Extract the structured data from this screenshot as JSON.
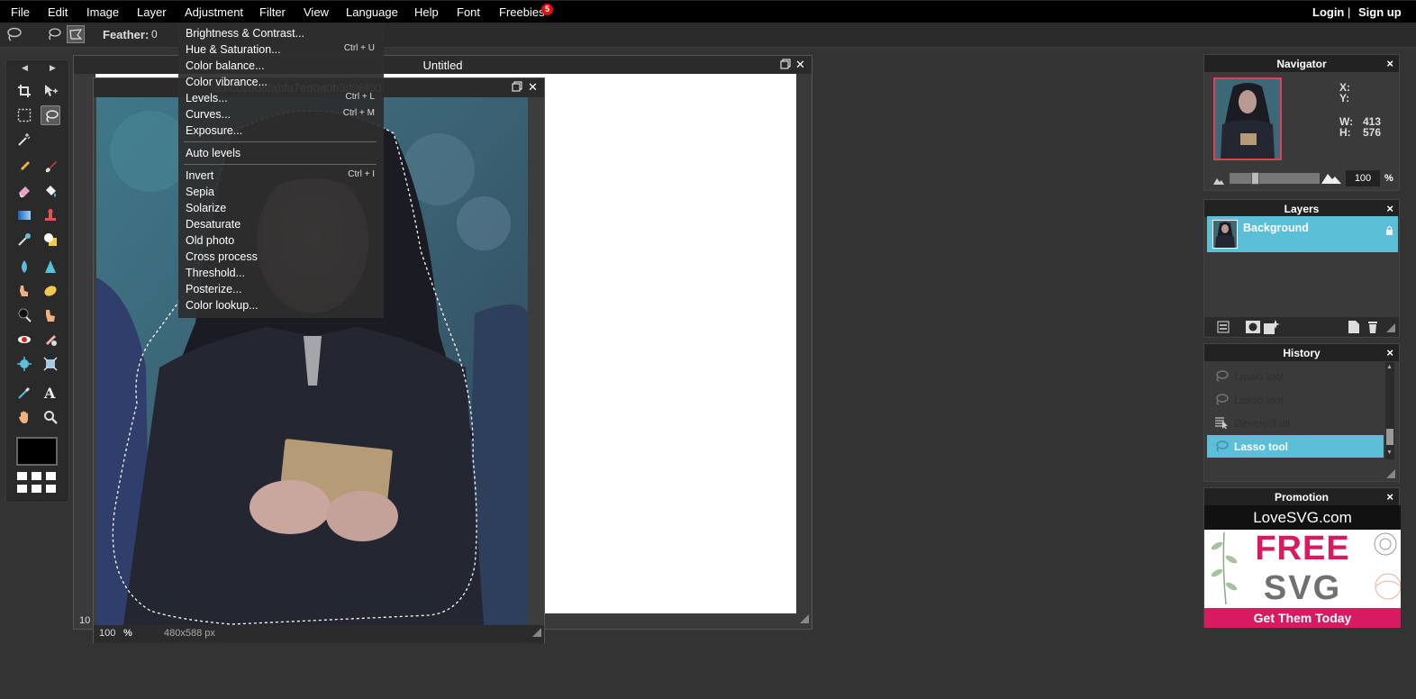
{
  "menubar": {
    "items": [
      "File",
      "Edit",
      "Image",
      "Layer",
      "Adjustment",
      "Filter",
      "View",
      "Language",
      "Help",
      "Font",
      "Freebies"
    ],
    "freebies_badge": "5",
    "login": "Login",
    "separator": "|",
    "signup": "Sign up"
  },
  "optionbar": {
    "feather_label": "Feather:",
    "feather_value": "0"
  },
  "doc_untitled": {
    "title": "Untitled",
    "zoom_stub": "10"
  },
  "doc_image": {
    "title": "fa3fcccbd8fabfa7ed0a0b3d06f00",
    "zoom": "100",
    "zoom_unit": "%",
    "dimensions": "480x588 px"
  },
  "adjustment_menu": {
    "groups": [
      [
        {
          "label": "Brightness & Contrast...",
          "shortcut": ""
        },
        {
          "label": "Hue & Saturation...",
          "shortcut": "Ctrl + U"
        },
        {
          "label": "Color balance...",
          "shortcut": ""
        },
        {
          "label": "Color vibrance...",
          "shortcut": ""
        },
        {
          "label": "Levels...",
          "shortcut": "Ctrl + L"
        },
        {
          "label": "Curves...",
          "shortcut": "Ctrl + M"
        },
        {
          "label": "Exposure...",
          "shortcut": ""
        }
      ],
      [
        {
          "label": "Auto levels",
          "shortcut": ""
        }
      ],
      [
        {
          "label": "Invert",
          "shortcut": "Ctrl + I"
        },
        {
          "label": "Sepia",
          "shortcut": ""
        },
        {
          "label": "Solarize",
          "shortcut": ""
        },
        {
          "label": "Desaturate",
          "shortcut": ""
        },
        {
          "label": "Old photo",
          "shortcut": ""
        },
        {
          "label": "Cross process",
          "shortcut": ""
        },
        {
          "label": "Threshold...",
          "shortcut": ""
        },
        {
          "label": "Posterize...",
          "shortcut": ""
        },
        {
          "label": "Color lookup...",
          "shortcut": ""
        }
      ]
    ]
  },
  "navigator": {
    "title": "Navigator",
    "x_label": "X:",
    "y_label": "Y:",
    "w_label": "W:",
    "w_value": "413",
    "h_label": "H:",
    "h_value": "576",
    "zoom": "100",
    "zoom_unit": "%",
    "zoom_slider_fraction": 0.27
  },
  "layers": {
    "title": "Layers",
    "items": [
      {
        "name": "Background",
        "locked": true
      }
    ]
  },
  "history": {
    "title": "History",
    "items": [
      {
        "name": "Lasso tool",
        "state": "dim",
        "icon": "lasso-icon"
      },
      {
        "name": "Lasso tool",
        "state": "dim",
        "icon": "lasso-icon"
      },
      {
        "name": "Deselect all",
        "state": "dim",
        "icon": "deselect-icon"
      },
      {
        "name": "Lasso tool",
        "state": "active",
        "icon": "lasso-icon"
      }
    ]
  },
  "promotion": {
    "title": "Promotion",
    "brand": "LoveSVG.com",
    "headline": "FREE",
    "subhead": "SVG",
    "cta": "Get Them Today"
  },
  "colors": {
    "accent": "#5bbfd8",
    "menubar_bg": "#000000",
    "workspace_bg": "#333333",
    "promo_pink": "#d81b60",
    "foreground_color": "#000000"
  }
}
